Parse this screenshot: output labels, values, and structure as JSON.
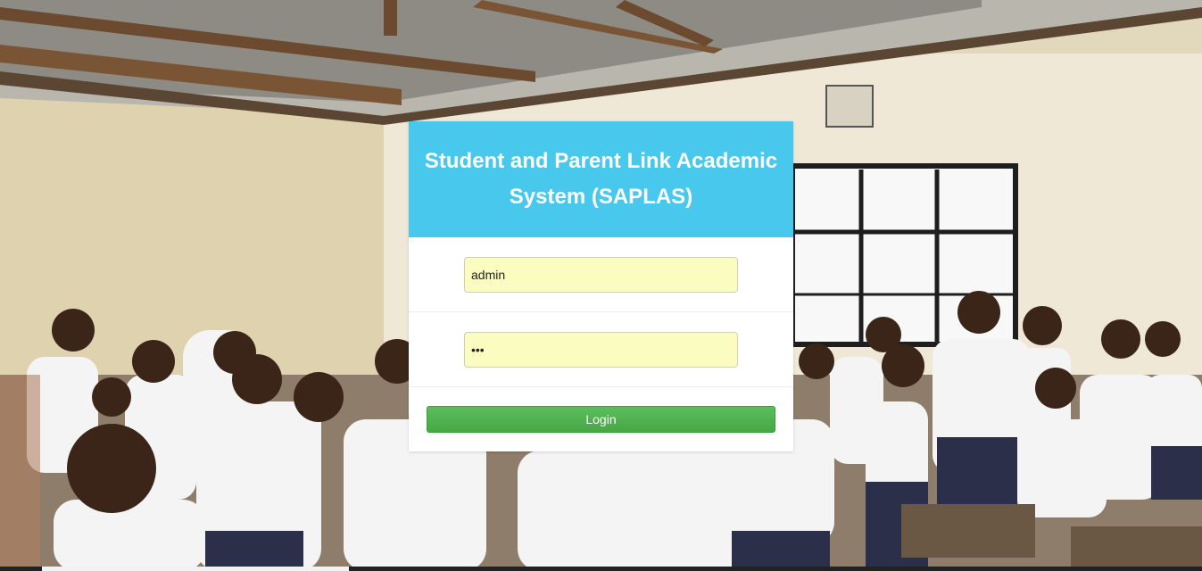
{
  "app": {
    "title": "Student and Parent Link Academic System (SAPLAS)"
  },
  "background": {
    "description_icon": "classroom-photo"
  },
  "login_form": {
    "username_value": "admin",
    "password_value": "•••",
    "login_label": "Login"
  },
  "colors": {
    "header_bg": "#47c8ec",
    "input_bg": "#fbfdc0",
    "button_green": "#4cae4c"
  }
}
